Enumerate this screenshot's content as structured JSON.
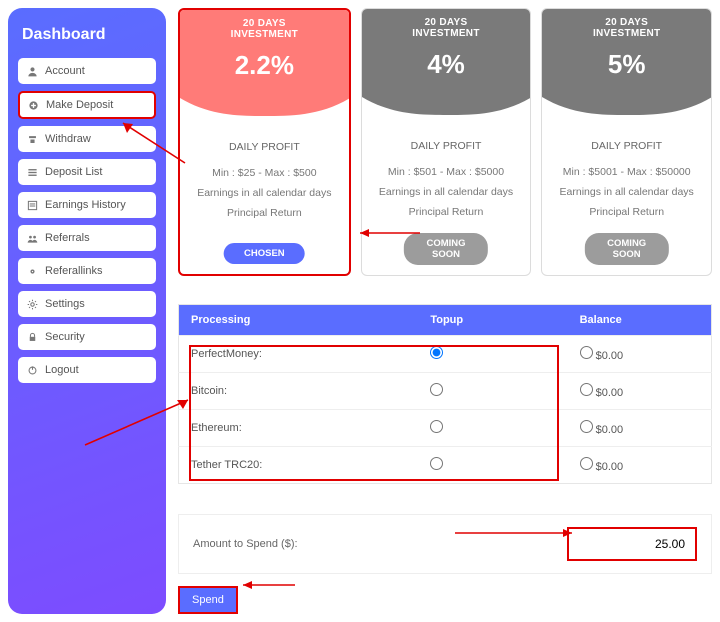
{
  "sidebar": {
    "title": "Dashboard",
    "items": [
      {
        "label": "Account",
        "icon": "user-icon"
      },
      {
        "label": "Make Deposit",
        "icon": "plus-icon"
      },
      {
        "label": "Withdraw",
        "icon": "withdraw-icon"
      },
      {
        "label": "Deposit List",
        "icon": "list-icon"
      },
      {
        "label": "Earnings History",
        "icon": "history-icon"
      },
      {
        "label": "Referrals",
        "icon": "people-icon"
      },
      {
        "label": "Referallinks",
        "icon": "link-icon"
      },
      {
        "label": "Settings",
        "icon": "gear-icon"
      },
      {
        "label": "Security",
        "icon": "lock-icon"
      },
      {
        "label": "Logout",
        "icon": "power-icon"
      }
    ]
  },
  "plans": [
    {
      "days": "20 DAYS",
      "title": "INVESTMENT",
      "rate": "2.2%",
      "daily_profit": "DAILY PROFIT",
      "range": "Min : $25 - Max : $500",
      "earnings": "Earnings in all calendar days",
      "principal": "Principal Return",
      "button": "CHOSEN",
      "color": "#ff7b78"
    },
    {
      "days": "20 DAYS",
      "title": "INVESTMENT",
      "rate": "4%",
      "daily_profit": "DAILY PROFIT",
      "range": "Min : $501 - Max : $5000",
      "earnings": "Earnings in all calendar days",
      "principal": "Principal Return",
      "button": "COMING SOON",
      "color": "#7a7a7a"
    },
    {
      "days": "20 DAYS",
      "title": "INVESTMENT",
      "rate": "5%",
      "daily_profit": "DAILY PROFIT",
      "range": "Min : $5001 - Max : $50000",
      "earnings": "Earnings in all calendar days",
      "principal": "Principal Return",
      "button": "COMING SOON",
      "color": "#7a7a7a"
    }
  ],
  "table": {
    "headers": {
      "processing": "Processing",
      "topup": "Topup",
      "balance": "Balance"
    },
    "rows": [
      {
        "name": "PerfectMoney:",
        "selected": true,
        "balance": "$0.00"
      },
      {
        "name": "Bitcoin:",
        "selected": false,
        "balance": "$0.00"
      },
      {
        "name": "Ethereum:",
        "selected": false,
        "balance": "$0.00"
      },
      {
        "name": "Tether TRC20:",
        "selected": false,
        "balance": "$0.00"
      }
    ]
  },
  "amount": {
    "label": "Amount to Spend ($):",
    "value": "25.00"
  },
  "spend_label": "Spend"
}
